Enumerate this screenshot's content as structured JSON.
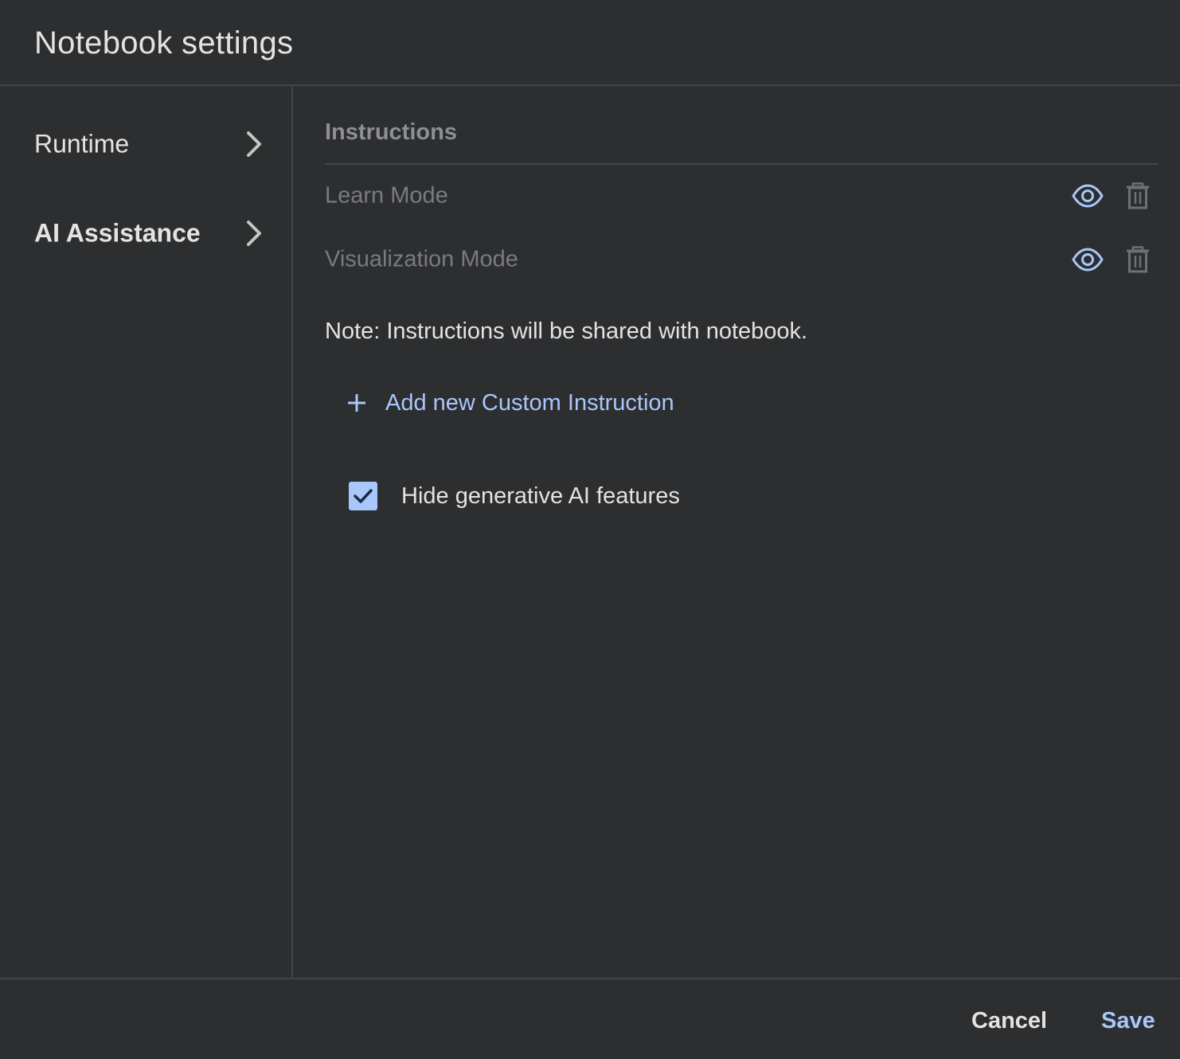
{
  "dialog": {
    "title": "Notebook settings"
  },
  "sidebar": {
    "items": [
      {
        "label": "Runtime",
        "active": false
      },
      {
        "label": "AI Assistance",
        "active": true
      }
    ]
  },
  "main": {
    "section_title": "Instructions",
    "instructions": [
      {
        "name": "Learn Mode"
      },
      {
        "name": "Visualization Mode"
      }
    ],
    "note": "Note: Instructions will be shared with notebook.",
    "add_button_label": "Add new Custom Instruction",
    "hide_ai_checkbox": {
      "label": "Hide generative AI features",
      "checked": true
    }
  },
  "footer": {
    "cancel_label": "Cancel",
    "save_label": "Save"
  },
  "colors": {
    "background": "#2d2e30",
    "accent": "#a8c7fa",
    "muted_text": "#7a7b7d",
    "divider": "#444547"
  },
  "icons": {
    "chevron": "chevron-right-icon",
    "eye": "eye-icon",
    "trash": "trash-icon",
    "plus": "plus-icon",
    "check": "check-icon"
  }
}
